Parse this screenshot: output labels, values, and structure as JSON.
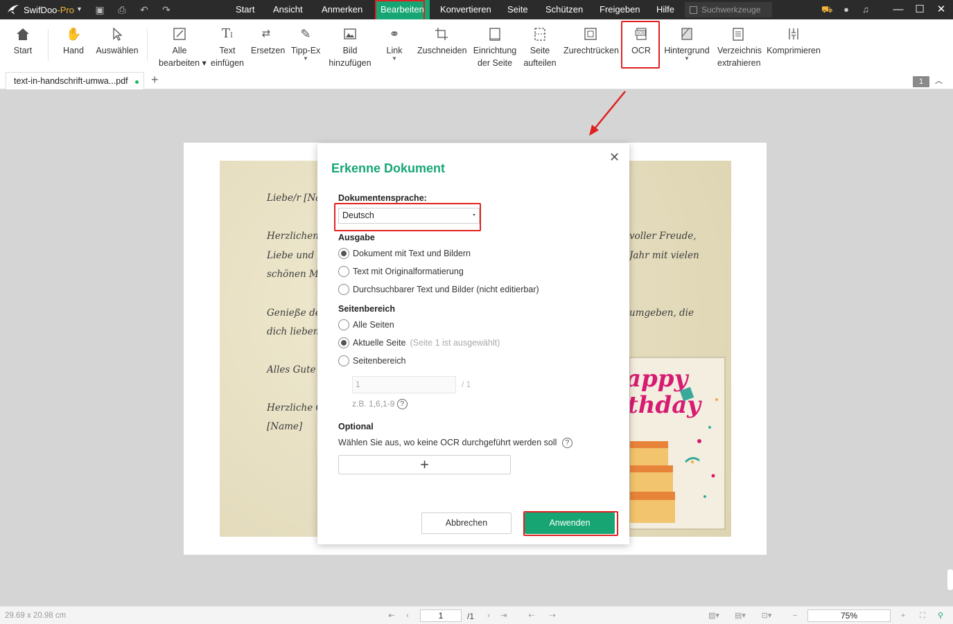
{
  "app": {
    "name": "SwifDoo",
    "name_suffix": "-Pro"
  },
  "menu": [
    {
      "label": "Start"
    },
    {
      "label": "Ansicht"
    },
    {
      "label": "Anmerken"
    },
    {
      "label": "Bearbeiten"
    },
    {
      "label": "Konvertieren"
    },
    {
      "label": "Seite"
    },
    {
      "label": "Schützen"
    },
    {
      "label": "Freigeben"
    },
    {
      "label": "Hilfe"
    }
  ],
  "active_menu": "Bearbeiten",
  "search": {
    "placeholder": "Suchwerkzeuge"
  },
  "ribbon": {
    "start": "Start",
    "hand": "Hand",
    "auswaehlen": "Auswählen",
    "alle_1": "Alle",
    "alle_2": "bearbeiten",
    "text_1": "Text",
    "text_2": "einfügen",
    "ersetzen": "Ersetzen",
    "tippex": "Tipp-Ex",
    "bild_1": "Bild",
    "bild_2": "hinzufügen",
    "link": "Link",
    "zuschneiden": "Zuschneiden",
    "einr_1": "Einrichtung",
    "einr_2": "der Seite",
    "seite_1": "Seite",
    "seite_2": "aufteilen",
    "zurecht": "Zurechtrücken",
    "ocr": "OCR",
    "hintergrund": "Hintergrund",
    "verz_1": "Verzeichnis",
    "verz_2": "extrahieren",
    "komprimieren": "Komprimieren"
  },
  "tab": {
    "filename": "text-in-handschrift-umwa...pdf"
  },
  "page_badge": "1",
  "letter": {
    "l1": "Liebe/r [Na",
    "l2": "Herzlichen",
    "l3": "Liebe und",
    "l4": "schönen Mo",
    "l5": "Genieße de",
    "l6": "dich lieben",
    "l7": "Alles Gute",
    "l8": "Herzliche G",
    "l9": "[Name]",
    "r1": "voller Freude,",
    "r2": "Jahr mit vielen",
    "r3": "umgeben, die",
    "card_1": "appy",
    "card_2": "thday"
  },
  "dialog": {
    "title": "Erkenne Dokument",
    "lang_label": "Dokumentensprache:",
    "lang_value": "Deutsch",
    "output_label": "Ausgabe",
    "output_options": [
      {
        "label": "Dokument mit Text und Bildern",
        "selected": true
      },
      {
        "label": "Text mit Originalformatierung",
        "selected": false
      },
      {
        "label": "Durchsuchbarer Text und Bilder (nicht editierbar)",
        "selected": false
      }
    ],
    "range_label": "Seitenbereich",
    "range_options": [
      {
        "label": "Alle Seiten",
        "selected": false
      },
      {
        "label": "Aktuelle Seite",
        "hint": "(Seite 1 ist ausgewählt)",
        "selected": true
      },
      {
        "label": "Seitenbereich",
        "selected": false
      }
    ],
    "range_input": "1",
    "range_total": "/ 1",
    "example": "z.B. 1,6,1-9",
    "optional_label": "Optional",
    "optional_text": "Wählen Sie aus, wo keine OCR durchgeführt werden soll",
    "help_glyph": "?",
    "add_glyph": "+",
    "cancel": "Abbrechen",
    "apply": "Anwenden"
  },
  "status": {
    "dimensions": "29.69 x 20.98 cm",
    "page_input": "1",
    "page_total": "/1",
    "zoom": "75%"
  },
  "colors": {
    "accent": "#17a673",
    "highlight": "#e02020",
    "titlebar": "#2b2b2b"
  }
}
